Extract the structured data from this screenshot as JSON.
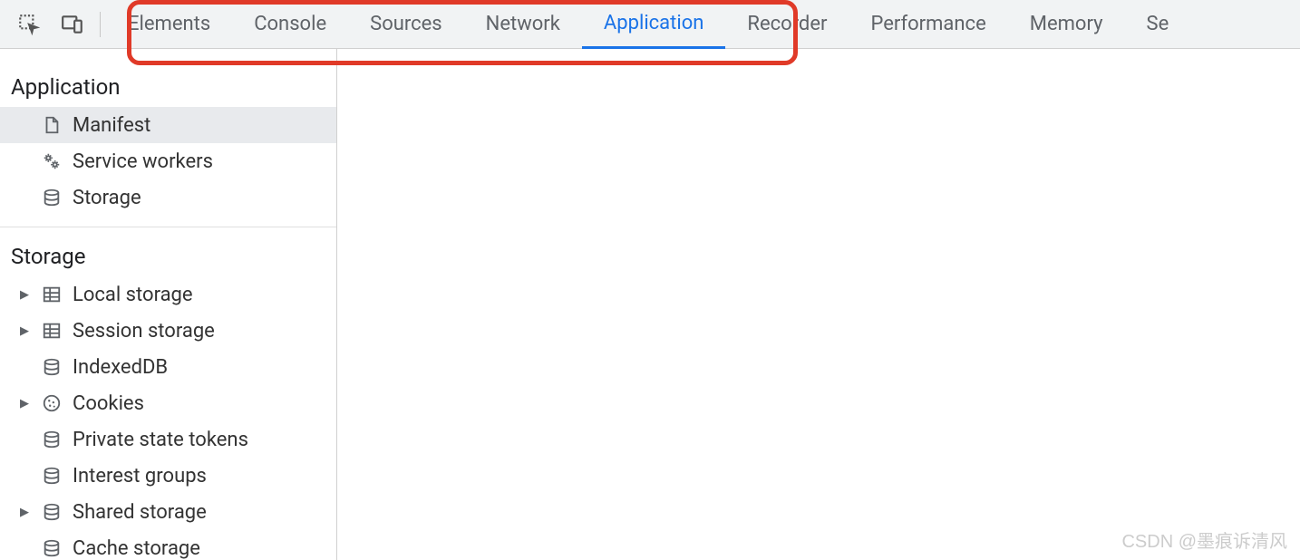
{
  "tabs": [
    {
      "label": "Elements",
      "active": false
    },
    {
      "label": "Console",
      "active": false
    },
    {
      "label": "Sources",
      "active": false
    },
    {
      "label": "Network",
      "active": false
    },
    {
      "label": "Application",
      "active": true
    },
    {
      "label": "Recorder",
      "active": false
    },
    {
      "label": "Performance",
      "active": false
    },
    {
      "label": "Memory",
      "active": false
    },
    {
      "label": "Se",
      "active": false
    }
  ],
  "sidebar": {
    "sections": [
      {
        "title": "Application",
        "items": [
          {
            "label": "Manifest",
            "icon": "file",
            "selected": true,
            "expandable": false
          },
          {
            "label": "Service workers",
            "icon": "gears",
            "selected": false,
            "expandable": false
          },
          {
            "label": "Storage",
            "icon": "database",
            "selected": false,
            "expandable": false
          }
        ]
      },
      {
        "title": "Storage",
        "items": [
          {
            "label": "Local storage",
            "icon": "table",
            "selected": false,
            "expandable": true
          },
          {
            "label": "Session storage",
            "icon": "table",
            "selected": false,
            "expandable": true
          },
          {
            "label": "IndexedDB",
            "icon": "database",
            "selected": false,
            "expandable": false
          },
          {
            "label": "Cookies",
            "icon": "cookie",
            "selected": false,
            "expandable": true
          },
          {
            "label": "Private state tokens",
            "icon": "database",
            "selected": false,
            "expandable": false
          },
          {
            "label": "Interest groups",
            "icon": "database",
            "selected": false,
            "expandable": false
          },
          {
            "label": "Shared storage",
            "icon": "database",
            "selected": false,
            "expandable": true
          },
          {
            "label": "Cache storage",
            "icon": "database",
            "selected": false,
            "expandable": false
          }
        ]
      }
    ]
  },
  "watermark": "CSDN @墨痕诉清风"
}
